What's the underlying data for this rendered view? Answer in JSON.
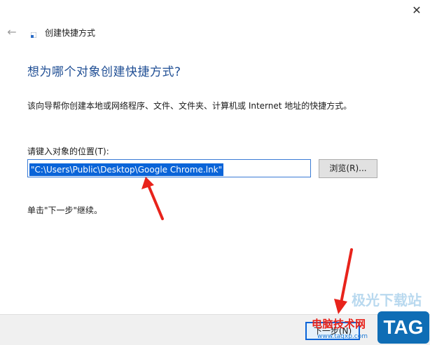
{
  "window": {
    "title": "创建快捷方式",
    "close_glyph": "✕",
    "back_glyph": "←"
  },
  "main": {
    "heading": "想为哪个对象创建快捷方式?",
    "description": "该向导帮你创建本地或网络程序、文件、文件夹、计算机或 Internet 地址的快捷方式。",
    "location_label": "请键入对象的位置(T):",
    "location_value": "\"C:\\Users\\Public\\Desktop\\Google Chrome.lnk\"",
    "browse_label": "浏览(R)...",
    "hint": "单击\"下一步\"继续。"
  },
  "footer": {
    "next_label": "下一步(N)"
  },
  "watermark": {
    "site_name": "电脑技术网",
    "site_url": "www.tagxp.com",
    "faint_text": "极光下载站",
    "tag_badge": "TAG"
  },
  "colors": {
    "heading": "#1f4e94",
    "selection": "#0a64d8",
    "annotation_arrow": "#e8231b",
    "watermark_red": "#e8231b",
    "watermark_blue": "#0f6db5"
  }
}
